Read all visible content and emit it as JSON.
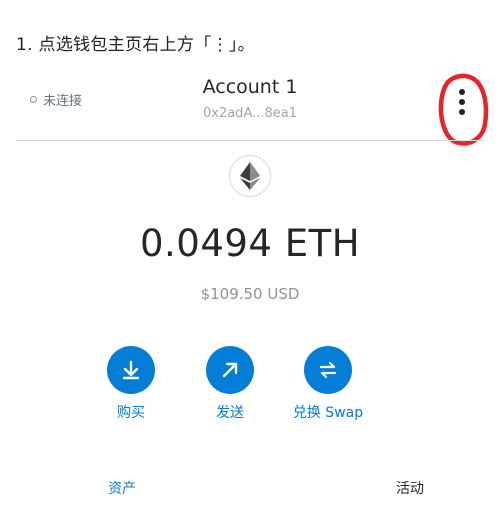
{
  "instruction": "1. 点选钱包主页右上方「⋮」。",
  "header": {
    "connection_status": "未连接",
    "account_name": "Account 1",
    "account_address": "0x2adA...8ea1"
  },
  "icons": {
    "menu": "kebab-menu-icon",
    "token": "ethereum-icon",
    "buy": "download-arrow-icon",
    "send": "diagonal-arrow-icon",
    "swap": "swap-arrows-icon"
  },
  "balance": {
    "amount": "0.0494 ETH",
    "fiat": "$109.50 USD"
  },
  "actions": [
    {
      "label": "购买"
    },
    {
      "label": "发送"
    },
    {
      "label": "兑换 Swap"
    }
  ],
  "tabs": [
    {
      "label": "资产"
    },
    {
      "label": "活动"
    }
  ],
  "colors": {
    "accent": "#037dd6",
    "highlight": "#e8232a",
    "text": "#24272a",
    "muted": "#8d9399"
  }
}
